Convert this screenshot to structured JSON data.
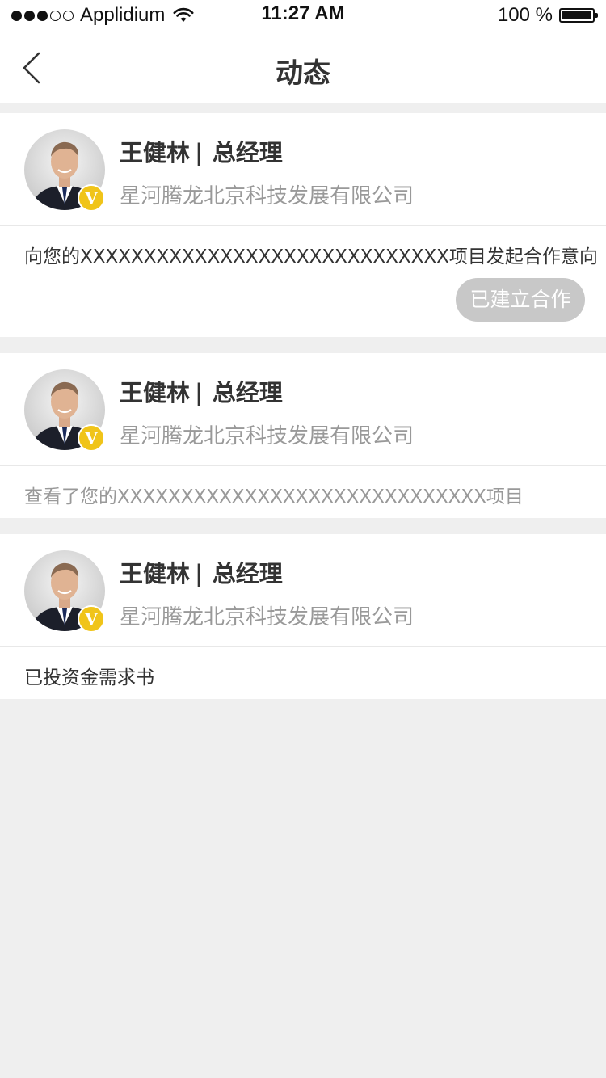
{
  "status_bar": {
    "carrier": "Applidium",
    "time": "11:27 AM",
    "battery": "100 %"
  },
  "nav": {
    "title": "动态",
    "back_icon": "chevron-left-icon"
  },
  "colors": {
    "background": "#efefef",
    "badge": "#f0c419",
    "button_gray": "#c8c8c8",
    "text_dark": "#333333",
    "text_gray": "#999999"
  },
  "activities": [
    {
      "name": "王健林",
      "separator": "|",
      "title": "总经理",
      "company": "星河腾龙北京科技发展有限公司",
      "badge": "V",
      "message": "向您的XXXXXXXXXXXXXXXXXXXXXXXXXXXXX项目发起合作意向",
      "button": "已建立合作"
    },
    {
      "name": "王健林",
      "separator": "|",
      "title": "总经理",
      "company": "星河腾龙北京科技发展有限公司",
      "badge": "V",
      "message": "查看了您的XXXXXXXXXXXXXXXXXXXXXXXXXXXXX项目"
    },
    {
      "name": "王健林",
      "separator": "|",
      "title": "总经理",
      "company": "星河腾龙北京科技发展有限公司",
      "badge": "V",
      "message": "已投资金需求书"
    }
  ]
}
